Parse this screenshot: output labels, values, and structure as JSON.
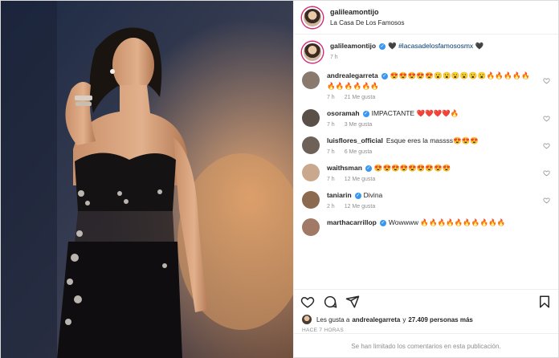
{
  "header": {
    "username": "galileamontijo",
    "location": "La Casa De Los Famosos"
  },
  "caption": {
    "username": "galileamontijo",
    "verified_symbol": "✓",
    "text_suffix": "🖤",
    "hashtag": "#lacasadelosfamososmx",
    "text_end": "🖤",
    "time": "7 h"
  },
  "comments": [
    {
      "username": "andrealegarreta",
      "verified": "✓",
      "text": "😍😍😍😍😍😮😮😮😮😮😮🔥🔥🔥🔥🔥🔥🔥🔥🔥🔥🔥",
      "time": "7 h",
      "likes": "21 Me gusta",
      "reply": "",
      "avatar_color": "#8a7a6e"
    },
    {
      "username": "osoramah",
      "verified": "✓",
      "text": "IMPACTANTE ❤️❤️❤️❤️🔥",
      "time": "7 h",
      "likes": "3 Me gusta",
      "reply": "",
      "avatar_color": "#5a5048"
    },
    {
      "username": "luisflores_official",
      "verified": "",
      "text": "Esque eres la massss😍😍😍",
      "time": "7 h",
      "likes": "6 Me gusta",
      "reply": "",
      "avatar_color": "#6e6258"
    },
    {
      "username": "waithsman",
      "verified": "✓",
      "text": "😍😍😍😍😍😍😍😍😍",
      "time": "7 h",
      "likes": "12 Me gusta",
      "reply": "",
      "avatar_color": "#c9a88e"
    },
    {
      "username": "taniarin",
      "verified": "✓",
      "text": "Divina",
      "time": "2 h",
      "likes": "12 Me gusta",
      "reply": "",
      "avatar_color": "#8c6a50"
    },
    {
      "username": "marthacarrillop",
      "verified": "✓",
      "text": "Wowwww 🔥🔥🔥🔥🔥🔥🔥🔥🔥🔥",
      "time": "",
      "likes": "",
      "reply": "",
      "avatar_color": "#a07a66"
    }
  ],
  "likes_line": {
    "prefix": "Les gusta a",
    "user": "andrealegarreta",
    "middle": "y",
    "count": "27.409 personas más"
  },
  "posted_ago": "HACE 7 HORAS",
  "comments_limited": "Se han limitado los comentarios en esta publicación.",
  "colors": {
    "link": "#00376b",
    "verified": "#3897f0",
    "muted": "#8e8e8e",
    "ring": "#d62976"
  },
  "icons": [
    "heart-icon",
    "comment-icon",
    "share-icon",
    "bookmark-icon"
  ]
}
